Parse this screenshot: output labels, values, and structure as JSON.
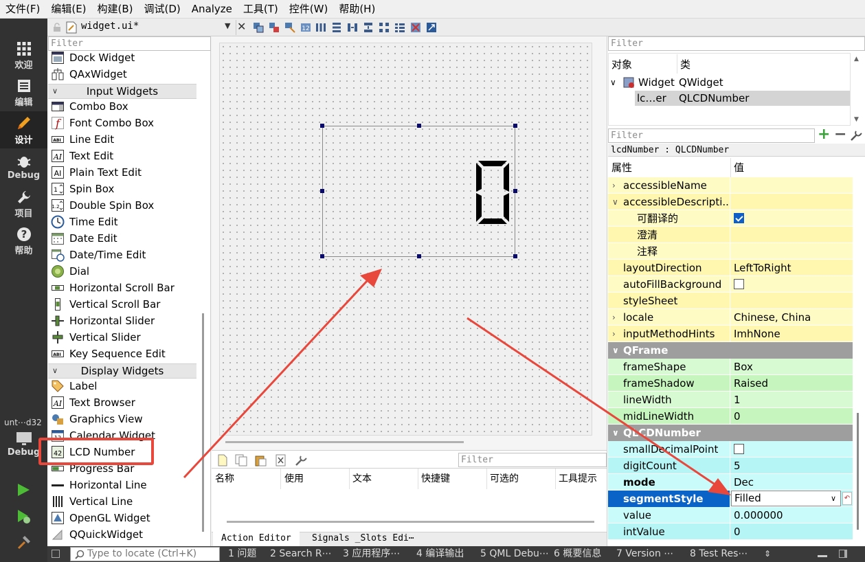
{
  "menu": [
    "文件(F)",
    "编辑(E)",
    "构建(B)",
    "调试(D)",
    "Analyze",
    "工具(T)",
    "控件(W)",
    "帮助(H)"
  ],
  "modes": [
    {
      "label": "欢迎",
      "icon": "grid-icon"
    },
    {
      "label": "编辑",
      "icon": "document-icon"
    },
    {
      "label": "设计",
      "icon": "pencil-icon"
    },
    {
      "label": "Debug",
      "icon": "bug-icon"
    },
    {
      "label": "项目",
      "icon": "wrench-icon"
    },
    {
      "label": "帮助",
      "icon": "help-icon"
    }
  ],
  "kit": {
    "label": "unt⋯d32",
    "mode": "Debug"
  },
  "document": {
    "filename": "widget.ui*"
  },
  "widgetbox": {
    "filter_placeholder": "Filter",
    "top_items": [
      "Dock Widget",
      "QAxWidget"
    ],
    "input_category": "Input Widgets",
    "input_items": [
      "Combo Box",
      "Font Combo Box",
      "Line Edit",
      "Text Edit",
      "Plain Text Edit",
      "Spin Box",
      "Double Spin Box",
      "Time Edit",
      "Date Edit",
      "Date/Time Edit",
      "Dial",
      "Horizontal Scroll Bar",
      "Vertical Scroll Bar",
      "Horizontal Slider",
      "Vertical Slider",
      "Key Sequence Edit"
    ],
    "display_category": "Display Widgets",
    "display_items": [
      "Label",
      "Text Browser",
      "Graphics View",
      "Calendar Widget",
      "LCD Number",
      "Progress Bar",
      "Horizontal Line",
      "Vertical Line",
      "OpenGL Widget",
      "QQuickWidget"
    ]
  },
  "form": {
    "lcd_digit": "0"
  },
  "action_editor": {
    "filter_placeholder": "Filter",
    "columns": [
      "名称",
      "使用",
      "文本",
      "快捷键",
      "可选的",
      "工具提示"
    ],
    "tabs": [
      "Action Editor",
      "Signals _Slots Edi⋯"
    ]
  },
  "object_inspector": {
    "filter_placeholder": "Filter",
    "headers": [
      "对象",
      "类"
    ],
    "rows": [
      {
        "object": "Widget",
        "class": "QWidget"
      },
      {
        "object": "lc…er",
        "class": "QLCDNumber"
      }
    ]
  },
  "property_editor": {
    "filter_placeholder": "Filter",
    "object_label": "lcdNumber : QLCDNumber",
    "headers": [
      "属性",
      "值"
    ],
    "qobject_rows": [
      {
        "name": "accessibleName",
        "value": ""
      },
      {
        "name": "accessibleDescripti...",
        "value": ""
      },
      {
        "name": "可翻译的",
        "value": ""
      },
      {
        "name": "澄清",
        "value": ""
      },
      {
        "name": "注释",
        "value": ""
      },
      {
        "name": "layoutDirection",
        "value": "LeftToRight"
      },
      {
        "name": "autoFillBackground",
        "value": ""
      },
      {
        "name": "styleSheet",
        "value": ""
      },
      {
        "name": "locale",
        "value": "Chinese, China"
      },
      {
        "name": "inputMethodHints",
        "value": "ImhNone"
      }
    ],
    "qframe_group": "QFrame",
    "qframe_rows": [
      {
        "name": "frameShape",
        "value": "Box"
      },
      {
        "name": "frameShadow",
        "value": "Raised"
      },
      {
        "name": "lineWidth",
        "value": "1"
      },
      {
        "name": "midLineWidth",
        "value": "0"
      }
    ],
    "lcd_group": "QLCDNumber",
    "lcd_rows": [
      {
        "name": "smallDecimalPoint",
        "value": ""
      },
      {
        "name": "digitCount",
        "value": "5"
      },
      {
        "name": "mode",
        "value": "Dec"
      },
      {
        "name": "segmentStyle",
        "value": "Filled"
      },
      {
        "name": "value",
        "value": "0.000000"
      },
      {
        "name": "intValue",
        "value": "0"
      }
    ]
  },
  "statusbar": {
    "locate_placeholder": "Type to locate (Ctrl+K)",
    "tabs": [
      "1 问题",
      "2 Search R⋯",
      "3 应用程序⋯",
      "4 编译输出",
      "5 QML Debu⋯",
      "6 概要信息",
      "7 Version ⋯",
      "8 Test Res⋯"
    ]
  },
  "colors": {
    "accent": "#0a64c8",
    "annotation": "#e8473c",
    "qobject_row": "#fffbc4",
    "qframe_row": "#d8fad2",
    "lcd_row": "#c9fbfb"
  }
}
